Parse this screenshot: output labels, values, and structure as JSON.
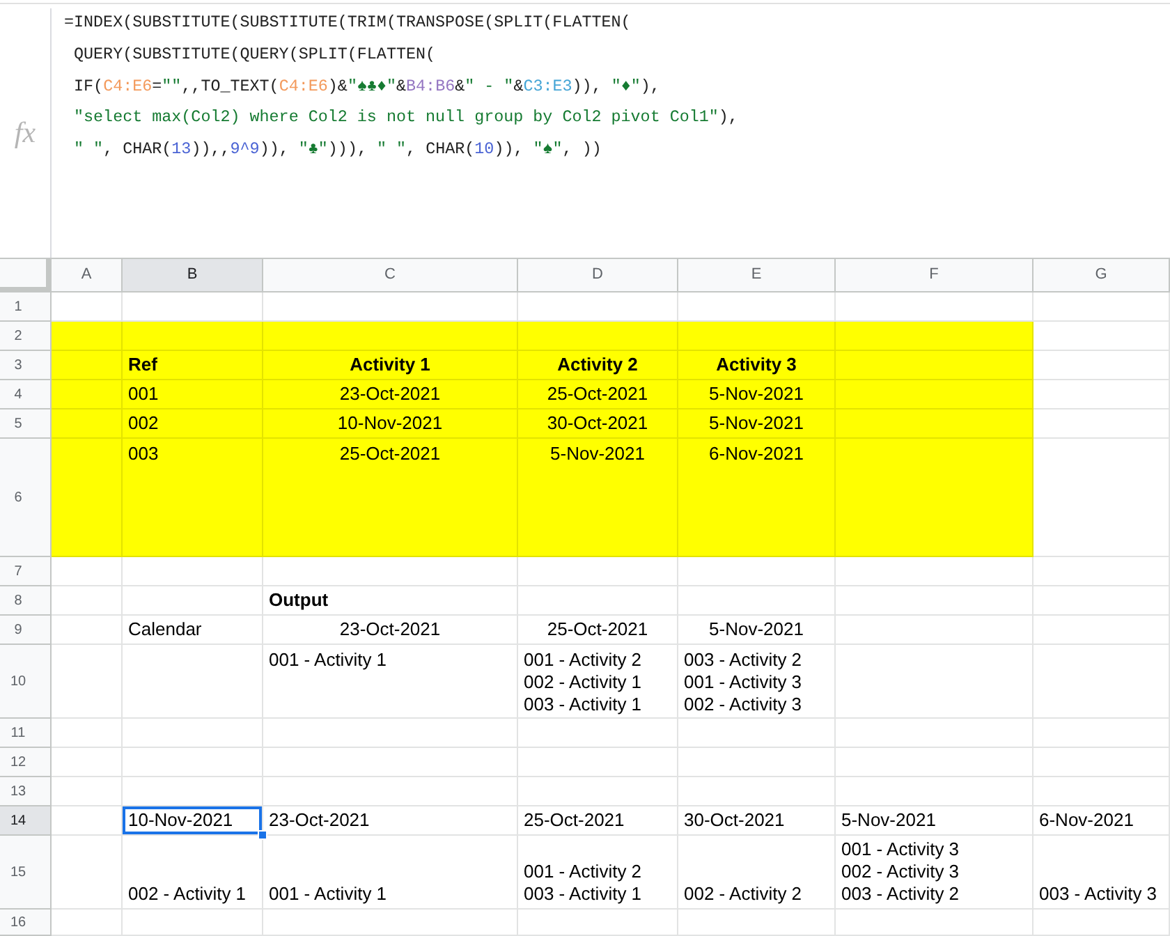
{
  "formula_bar": {
    "label": "fx",
    "lines": [
      [
        {
          "kind": "plain",
          "text": "=INDEX(SUBSTITUTE(SUBSTITUTE(TRIM(TRANSPOSE(SPLIT(FLATTEN("
        }
      ],
      [
        {
          "kind": "plain",
          "text": " QUERY(SUBSTITUTE(QUERY(SPLIT(FLATTEN("
        }
      ],
      [
        {
          "kind": "plain",
          "text": " IF("
        },
        {
          "kind": "range",
          "text": "C4:E6",
          "color": "#f39a5c"
        },
        {
          "kind": "plain",
          "text": "="
        },
        {
          "kind": "string",
          "text": "\"\""
        },
        {
          "kind": "plain",
          "text": ",,TO_TEXT("
        },
        {
          "kind": "range",
          "text": "C4:E6",
          "color": "#f39a5c"
        },
        {
          "kind": "plain",
          "text": ")&"
        },
        {
          "kind": "string",
          "text": "\"♠♣♦\""
        },
        {
          "kind": "plain",
          "text": "&"
        },
        {
          "kind": "range",
          "text": "B4:B6",
          "color": "#9576c2"
        },
        {
          "kind": "plain",
          "text": "&"
        },
        {
          "kind": "string",
          "text": "\" - \""
        },
        {
          "kind": "plain",
          "text": "&"
        },
        {
          "kind": "range",
          "text": "C3:E3",
          "color": "#45a5d6"
        },
        {
          "kind": "plain",
          "text": ")), "
        },
        {
          "kind": "string",
          "text": "\"♦\""
        },
        {
          "kind": "plain",
          "text": "),"
        }
      ],
      [
        {
          "kind": "string",
          "text": " \"select max(Col2) where Col2 is not null group by Col2 pivot Col1\""
        },
        {
          "kind": "plain",
          "text": "),"
        }
      ],
      [
        {
          "kind": "string",
          "text": " \" \""
        },
        {
          "kind": "plain",
          "text": ", CHAR("
        },
        {
          "kind": "number",
          "text": "13"
        },
        {
          "kind": "plain",
          "text": ")),,"
        },
        {
          "kind": "number",
          "text": "9^9"
        },
        {
          "kind": "plain",
          "text": ")), "
        },
        {
          "kind": "string",
          "text": "\"♣\""
        },
        {
          "kind": "plain",
          "text": "))), "
        },
        {
          "kind": "string",
          "text": "\" \""
        },
        {
          "kind": "plain",
          "text": ", CHAR("
        },
        {
          "kind": "number",
          "text": "10"
        },
        {
          "kind": "plain",
          "text": ")), "
        },
        {
          "kind": "string",
          "text": "\"♠\""
        },
        {
          "kind": "plain",
          "text": ", ))"
        }
      ]
    ]
  },
  "grid": {
    "columns": [
      {
        "label": "A",
        "selected": false
      },
      {
        "label": "B",
        "selected": true
      },
      {
        "label": "C",
        "selected": false
      },
      {
        "label": "D",
        "selected": false
      },
      {
        "label": "E",
        "selected": false
      },
      {
        "label": "F",
        "selected": false
      },
      {
        "label": "G",
        "selected": false
      }
    ],
    "rows": [
      {
        "number": "1",
        "selected": false
      },
      {
        "number": "2",
        "selected": false,
        "color": "#ffff00"
      },
      {
        "number": "3",
        "selected": false,
        "color": "#ffff00",
        "cells": [
          null,
          "Ref",
          "Activity 1",
          "Activity 2",
          "Activity 3"
        ]
      },
      {
        "number": "4",
        "selected": false,
        "color": "#ffff00",
        "cells": [
          null,
          "001",
          "23-Oct-2021",
          "25-Oct-2021",
          "5-Nov-2021"
        ]
      },
      {
        "number": "5",
        "selected": false,
        "color": "#ffff00",
        "cells": [
          null,
          "002",
          "10-Nov-2021",
          "30-Oct-2021",
          "5-Nov-2021"
        ]
      },
      {
        "number": "6",
        "selected": false,
        "color": "#ffff00",
        "cells": [
          null,
          "003",
          "25-Oct-2021",
          "5-Nov-2021",
          "6-Nov-2021"
        ]
      },
      {
        "number": "7",
        "selected": false
      },
      {
        "number": "8",
        "selected": false,
        "cells": [
          null,
          null,
          "Output"
        ]
      },
      {
        "number": "9",
        "selected": false,
        "cells": [
          null,
          "Calendar",
          "23-Oct-2021",
          "25-Oct-2021",
          "5-Nov-2021"
        ]
      },
      {
        "number": "10",
        "selected": false,
        "cells": [
          null,
          null,
          "001 - Activity 1",
          "001 - Activity 2\n002 - Activity 1\n003 - Activity 1",
          "003 - Activity 2\n001 - Activity 3\n002 - Activity 3"
        ]
      },
      {
        "number": "11",
        "selected": false
      },
      {
        "number": "12",
        "selected": false
      },
      {
        "number": "13",
        "selected": false
      },
      {
        "number": "14",
        "selected": true,
        "cells": [
          null,
          "10-Nov-2021",
          "23-Oct-2021",
          "25-Oct-2021",
          "30-Oct-2021",
          "5-Nov-2021",
          "6-Nov-2021"
        ]
      },
      {
        "number": "15",
        "selected": false,
        "cells": [
          null,
          "002 - Activity 1",
          "001 - Activity 1",
          "001 - Activity 2\n003 - Activity 1",
          "002 - Activity 2",
          "001 - Activity 3\n002 - Activity 3\n003 - Activity 2",
          "003 - Activity 3"
        ]
      },
      {
        "number": "16",
        "selected": false
      }
    ]
  }
}
